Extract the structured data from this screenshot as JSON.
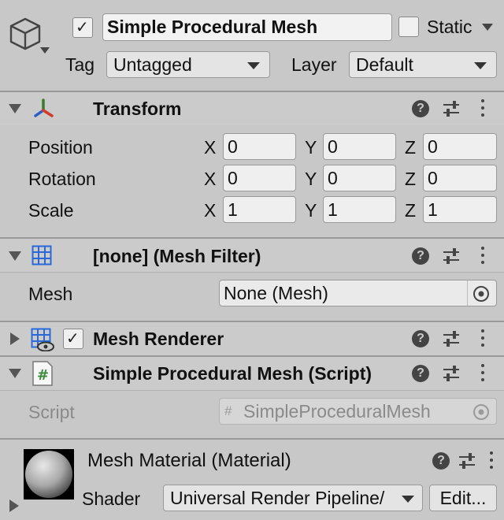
{
  "object": {
    "active": true,
    "name": "Simple Procedural Mesh",
    "static_label": "Static",
    "static_checked": false,
    "tag_label": "Tag",
    "tag_value": "Untagged",
    "layer_label": "Layer",
    "layer_value": "Default"
  },
  "transform": {
    "title": "Transform",
    "rows": [
      {
        "label": "Position",
        "x": "0",
        "y": "0",
        "z": "0"
      },
      {
        "label": "Rotation",
        "x": "0",
        "y": "0",
        "z": "0"
      },
      {
        "label": "Scale",
        "x": "1",
        "y": "1",
        "z": "1"
      }
    ],
    "axis_x": "X",
    "axis_y": "Y",
    "axis_z": "Z"
  },
  "mesh_filter": {
    "title": "[none] (Mesh Filter)",
    "mesh_label": "Mesh",
    "mesh_value": "None (Mesh)"
  },
  "mesh_renderer": {
    "title": "Mesh Renderer",
    "enabled": true
  },
  "script_component": {
    "title": "Simple Procedural Mesh (Script)",
    "script_label": "Script",
    "script_value": "SimpleProceduralMesh",
    "hash_glyph": "#"
  },
  "material": {
    "title": "Mesh Material (Material)",
    "shader_label": "Shader",
    "shader_value": "Universal Render Pipeline/",
    "edit_label": "Edit..."
  },
  "icons": {
    "help": "?",
    "check": "✓"
  }
}
